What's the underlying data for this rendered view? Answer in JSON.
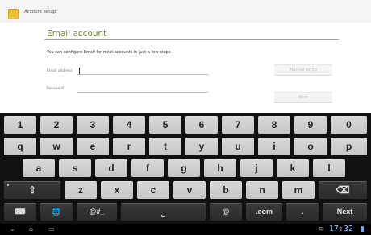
{
  "app": {
    "bar_title": "Account setup"
  },
  "form": {
    "section_title": "Email account",
    "description": "You can configure Email for most accounts in just a few steps.",
    "email_label": "Email address",
    "email_value": "",
    "password_label": "Password",
    "password_value": "",
    "manual_setup_label": "Manual setup",
    "next_button_label": "Next"
  },
  "keyboard": {
    "row1": [
      "1",
      "2",
      "3",
      "4",
      "5",
      "6",
      "7",
      "8",
      "9",
      "0"
    ],
    "row2": [
      "q",
      "w",
      "e",
      "r",
      "t",
      "y",
      "u",
      "i",
      "o",
      "p"
    ],
    "row3": [
      "a",
      "s",
      "d",
      "f",
      "g",
      "h",
      "j",
      "k",
      "l"
    ],
    "row4": [
      "z",
      "x",
      "c",
      "v",
      "b",
      "n",
      "m"
    ],
    "shift_glyph": "⇧",
    "backspace_glyph": "⌫",
    "keyboard_glyph": "⌨",
    "globe_glyph": "🌐",
    "symbols_label": "@#_",
    "space_glyph": "⎵",
    "at_label": "@",
    "com_label": ".com",
    "period_label": ".",
    "next_label": "Next"
  },
  "system": {
    "clock": "17:32",
    "back_glyph": "⌄",
    "home_glyph": "⌂",
    "recent_glyph": "▭",
    "wifi_glyph": "≋",
    "signal_glyph": "▮"
  },
  "colors": {
    "accent_green": "#6e8f2b",
    "keyboard_bg": "#111111",
    "key_light": "#d0d0d0",
    "key_dark": "#333333",
    "clock_blue": "#9ec5ff"
  },
  "icons": {
    "app": "email-app-icon",
    "shift": "shift-icon",
    "backspace": "backspace-icon",
    "keyboard_settings": "keyboard-settings-icon",
    "globe": "language-globe-icon",
    "nav_back": "back-icon",
    "nav_home": "home-icon",
    "nav_recent": "recent-apps-icon",
    "wifi": "wifi-icon",
    "signal": "signal-icon"
  }
}
